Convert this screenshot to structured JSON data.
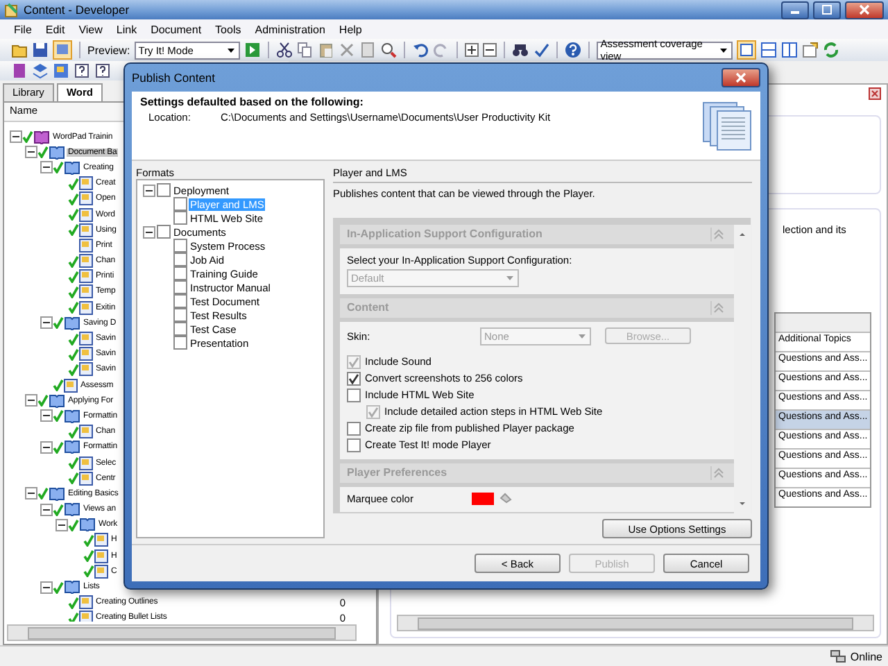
{
  "window": {
    "title": "Content - Developer"
  },
  "menu": [
    "File",
    "Edit",
    "View",
    "Link",
    "Document",
    "Tools",
    "Administration",
    "Help"
  ],
  "toolbar": {
    "preview_label": "Preview:",
    "preview_mode": "Try It! Mode",
    "view_mode": "Assessment coverage view"
  },
  "tabs": [
    {
      "label": "Library",
      "selected": false
    },
    {
      "label": "Word",
      "selected": true
    }
  ],
  "tree": {
    "column": "Name",
    "items": [
      {
        "label": "WordPad Trainin",
        "checked": true,
        "selected": false,
        "children": [
          {
            "label": "Document Ba",
            "checked": true,
            "selected": true,
            "children": [
              {
                "label": "Creating",
                "checked": true,
                "selected": false,
                "children": [
                  {
                    "label": "Creat",
                    "checked": true,
                    "selected": false
                  },
                  {
                    "label": "Open",
                    "checked": true,
                    "selected": false
                  },
                  {
                    "label": "Word",
                    "checked": true,
                    "selected": false
                  },
                  {
                    "label": "Using",
                    "checked": true,
                    "selected": false
                  },
                  {
                    "label": "Print",
                    "checked": false,
                    "selected": false
                  },
                  {
                    "label": "Chan",
                    "checked": true,
                    "selected": false
                  },
                  {
                    "label": "Printi",
                    "checked": true,
                    "selected": false
                  },
                  {
                    "label": "Temp",
                    "checked": true,
                    "selected": false
                  },
                  {
                    "label": "Exitin",
                    "checked": true,
                    "selected": false
                  }
                ]
              },
              {
                "label": "Saving D",
                "checked": true,
                "selected": false,
                "children": [
                  {
                    "label": "Savin",
                    "checked": true,
                    "selected": false
                  },
                  {
                    "label": "Savin",
                    "checked": true,
                    "selected": false
                  },
                  {
                    "label": "Savin",
                    "checked": true,
                    "selected": false
                  }
                ]
              },
              {
                "label": "Assessm",
                "checked": true,
                "selected": false
              }
            ]
          },
          {
            "label": "Applying For",
            "checked": true,
            "selected": false,
            "children": [
              {
                "label": "Formattin",
                "checked": true,
                "selected": false,
                "children": [
                  {
                    "label": "Chan",
                    "checked": true,
                    "selected": false
                  }
                ]
              },
              {
                "label": "Formattin",
                "checked": true,
                "selected": false,
                "children": [
                  {
                    "label": "Selec",
                    "checked": true,
                    "selected": false
                  },
                  {
                    "label": "Centr",
                    "checked": true,
                    "selected": false
                  }
                ]
              }
            ]
          },
          {
            "label": "Editing Basics",
            "checked": true,
            "selected": false,
            "children": [
              {
                "label": "Views an",
                "checked": true,
                "selected": false,
                "children": [
                  {
                    "label": "Work",
                    "checked": true,
                    "selected": false,
                    "children": [
                      {
                        "label": "H",
                        "checked": true,
                        "selected": false
                      },
                      {
                        "label": "H",
                        "checked": true,
                        "selected": false
                      },
                      {
                        "label": "C",
                        "checked": true,
                        "selected": false
                      }
                    ]
                  }
                ]
              },
              {
                "label": "Lists",
                "checked": true,
                "selected": false,
                "children": [
                  {
                    "label": "Creating Outlines",
                    "checked": true,
                    "selected": false,
                    "count": "0"
                  },
                  {
                    "label": "Creating Bullet Lists",
                    "checked": true,
                    "selected": false,
                    "count": "0"
                  }
                ]
              }
            ]
          }
        ]
      }
    ]
  },
  "main_right": {
    "description": "lection and its",
    "column": "Additional Topics",
    "rows": [
      {
        "text": "Questions and Ass...",
        "selected": false
      },
      {
        "text": "Questions and Ass...",
        "selected": false
      },
      {
        "text": "Questions and Ass...",
        "selected": false
      },
      {
        "text": "Questions and Ass...",
        "selected": true
      },
      {
        "text": "Questions and Ass...",
        "selected": false
      },
      {
        "text": "Questions and Ass...",
        "selected": false
      },
      {
        "text": "Questions and Ass...",
        "selected": false
      },
      {
        "text": "Questions and Ass...",
        "selected": false
      }
    ]
  },
  "dialog": {
    "title": "Publish Content",
    "heading": "Settings defaulted based on the following:",
    "location_label": "Location:",
    "location": "C:\\Documents and Settings\\Username\\Documents\\User Productivity Kit",
    "formats_label": "Formats",
    "formats": [
      {
        "label": "Deployment",
        "checked": false,
        "selected": false,
        "children": [
          {
            "label": "Player and LMS",
            "checked": false,
            "selected": true
          },
          {
            "label": "HTML Web Site",
            "checked": false,
            "selected": false
          }
        ]
      },
      {
        "label": "Documents",
        "checked": false,
        "selected": false,
        "children": [
          {
            "label": "System Process",
            "checked": false,
            "selected": false
          },
          {
            "label": "Job Aid",
            "checked": false,
            "selected": false
          },
          {
            "label": "Training Guide",
            "checked": false,
            "selected": false
          },
          {
            "label": "Instructor Manual",
            "checked": false,
            "selected": false
          },
          {
            "label": "Test Document",
            "checked": false,
            "selected": false
          },
          {
            "label": "Test Results",
            "checked": false,
            "selected": false
          },
          {
            "label": "Test Case",
            "checked": false,
            "selected": false
          },
          {
            "label": "Presentation",
            "checked": false,
            "selected": false
          }
        ]
      }
    ],
    "panel": {
      "title": "Player and LMS",
      "description": "Publishes content that can be viewed through the Player.",
      "sections": [
        {
          "kind": "config",
          "title": "In-Application Support Configuration",
          "label": "Select your In-Application Support Configuration:",
          "dropdown": {
            "value": "Default",
            "disabled": true
          }
        },
        {
          "kind": "content",
          "title": "Content",
          "skin_label": "Skin:",
          "skin": {
            "value": "None",
            "disabled": true
          },
          "browse": {
            "label": "Browse...",
            "disabled": true
          },
          "options": [
            {
              "label": "Include Sound",
              "checked": true,
              "disabled": true
            },
            {
              "label": "Convert screenshots to 256 colors",
              "checked": true,
              "disabled": false
            },
            {
              "label": "Include HTML Web Site",
              "checked": false,
              "disabled": false,
              "children": [
                {
                  "label": "Include detailed action steps in HTML Web Site",
                  "checked": true,
                  "disabled": true
                }
              ]
            },
            {
              "label": "Create zip file from published Player package",
              "checked": false,
              "disabled": false
            },
            {
              "label": "Create Test It! mode Player",
              "checked": false,
              "disabled": false
            }
          ]
        },
        {
          "kind": "prefs",
          "title": "Player Preferences",
          "label": "Marquee color",
          "color": "#ff0000"
        }
      ]
    },
    "use_options": "Use Options Settings",
    "buttons": [
      {
        "label": "< Back",
        "disabled": false
      },
      {
        "label": "Publish",
        "disabled": true
      },
      {
        "label": "Cancel",
        "disabled": false
      }
    ]
  },
  "status_bar": {
    "text": "Online"
  }
}
